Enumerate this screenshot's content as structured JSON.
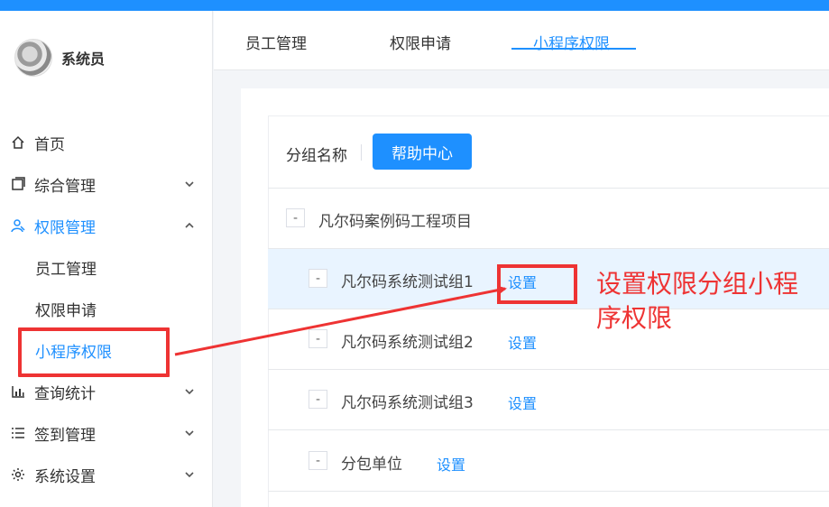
{
  "colors": {
    "accent": "#1e90ff",
    "annotation": "#ee3333",
    "topbar": "#1e90ff"
  },
  "profile": {
    "name": "系统员",
    "avatar_icon": "avatar-image"
  },
  "sidebar": {
    "items": [
      {
        "label": "首页",
        "icon": "home-icon"
      },
      {
        "label": "综合管理",
        "icon": "overview-icon",
        "chevron": "down"
      },
      {
        "label": "权限管理",
        "icon": "user-permission-icon",
        "chevron": "up",
        "expanded": true
      },
      {
        "label": "查询统计",
        "icon": "bar-chart-icon",
        "chevron": "down"
      },
      {
        "label": "签到管理",
        "icon": "list-icon",
        "chevron": "down"
      },
      {
        "label": "系统设置",
        "icon": "gear-icon",
        "chevron": "down"
      }
    ],
    "subitems": [
      {
        "label": "员工管理"
      },
      {
        "label": "权限申请"
      },
      {
        "label": "小程序权限",
        "selected": true
      }
    ]
  },
  "tabs": [
    {
      "label": "员工管理"
    },
    {
      "label": "权限申请"
    },
    {
      "label": "小程序权限",
      "active": true
    }
  ],
  "toolbar": {
    "label": "分组名称",
    "help_button": "帮助中心"
  },
  "tree": {
    "root": {
      "toggle": "-",
      "label": "凡尔码案例码工程项目"
    },
    "rows": [
      {
        "toggle": "-",
        "label": "凡尔码系统测试组1",
        "action": "设置",
        "highlighted": true
      },
      {
        "toggle": "-",
        "label": "凡尔码系统测试组2",
        "action": "设置"
      },
      {
        "toggle": "-",
        "label": "凡尔码系统测试组3",
        "action": "设置"
      },
      {
        "toggle": "-",
        "label": "分包单位",
        "action": "设置"
      }
    ]
  },
  "annotation": {
    "text": "设置权限分组小程序权限"
  }
}
